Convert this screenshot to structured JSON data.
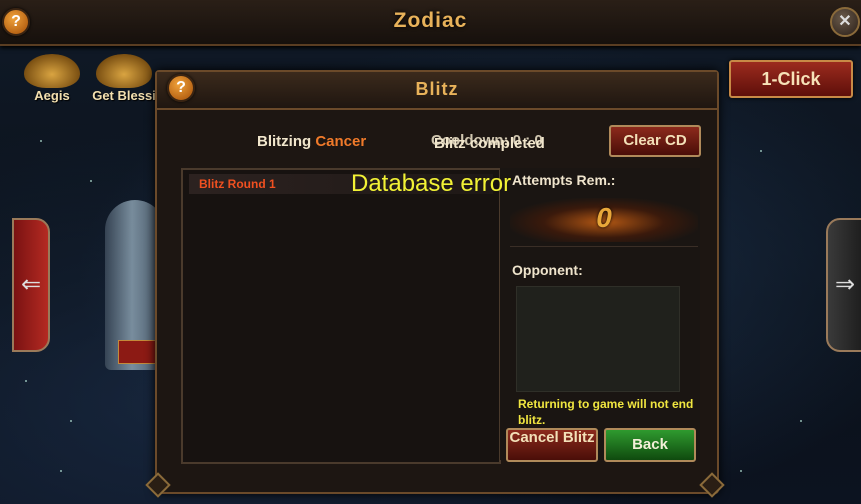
{
  "zodiac": {
    "title": "Zodiac",
    "help": "?",
    "close": "✕"
  },
  "side_items": [
    {
      "label": "Aegis"
    },
    {
      "label": "Get Blessi"
    }
  ],
  "one_click": {
    "label": "1-Click"
  },
  "nav": {
    "left_glyph": "⇐",
    "right_glyph": "⇒"
  },
  "blitz": {
    "title": "Blitz",
    "help": "?",
    "blitzing_prefix": "Blitzing",
    "zodiac_sign": "Cancer",
    "cooldown": "Cooldown: 0 : 0",
    "completed": "Blitz completed",
    "clear_cd": "Clear CD",
    "rounds": [
      {
        "label": "Blitz Round 1"
      }
    ],
    "attempts_label": "Attempts Rem.:",
    "attempts_value": "0",
    "opponent_label": "Opponent:",
    "notice": "Returning to game will not end blitz.",
    "cancel_blitz": "Cancel Blitz",
    "back": "Back"
  },
  "error": {
    "message": "Database error"
  },
  "colors": {
    "accent": "#e8b25a",
    "zodiac_sign": "#f07a2a",
    "round_text": "#f05020",
    "error": "#f2f235"
  }
}
